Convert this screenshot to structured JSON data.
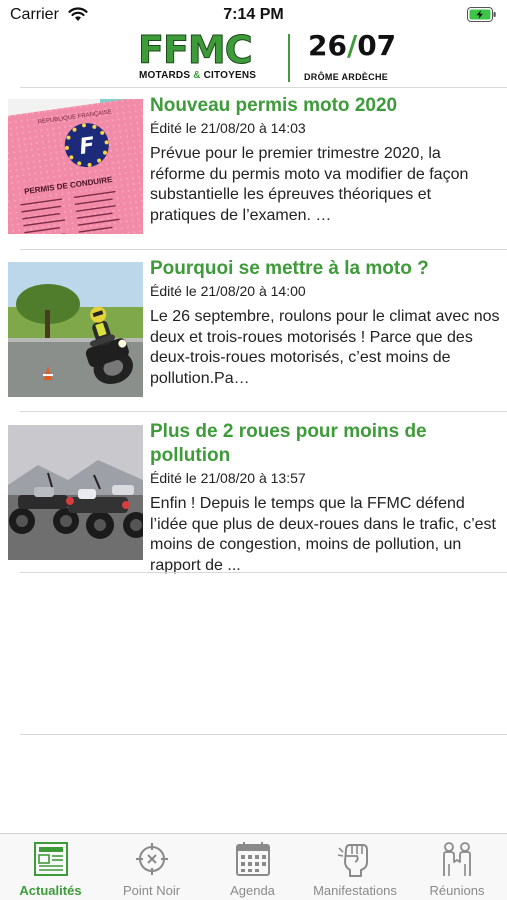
{
  "status_bar": {
    "carrier": "Carrier",
    "time": "7:14 PM",
    "wifi_icon": "wifi-icon",
    "battery_icon": "battery-charging-icon"
  },
  "header": {
    "logo_main": "FFMC",
    "logo_sub_left": "MOTARDS",
    "logo_sub_amp": "&",
    "logo_sub_right": "CITOYENS",
    "logo_num_left": "26",
    "logo_num_slash": "/",
    "logo_num_right": "07",
    "logo_region": "DRÔME ARDÈCHE"
  },
  "news": [
    {
      "title": "Nouveau permis moto 2020",
      "date": "Édité le 21/08/20 à 14:03",
      "excerpt": "Prévue pour le premier trimestre 2020, la réforme du permis moto va modifier de façon substantielle les épreuves théoriques et pratiques de l’examen. …",
      "thumb": {
        "card_header": "RÉPUBLIQUE FRANÇAISE",
        "card_letter": "F",
        "card_label": "PERMIS DE CONDUIRE"
      }
    },
    {
      "title": "Pourquoi se mettre à la moto ?",
      "date": "Édité le 21/08/20 à 14:00",
      "excerpt": "Le 26 septembre, roulons pour le climat avec nos deux et trois-roues motorisés ! Parce que des deux-trois-roues motorisés, c’est moins de pollution.Pa…"
    },
    {
      "title": "Plus de 2 roues pour moins de pollution",
      "date": "Édité le 21/08/20 à 13:57",
      "excerpt": "Enfin ! Depuis le temps que la FFMC défend l’idée que plus de deux-roues dans le trafic, c’est moins de congestion, moins de pollution, un rapport de ..."
    }
  ],
  "tabs": [
    {
      "label": "Actualités",
      "icon": "newspaper-icon",
      "active": true
    },
    {
      "label": "Point Noir",
      "icon": "crosshair-icon",
      "active": false
    },
    {
      "label": "Agenda",
      "icon": "calendar-icon",
      "active": false
    },
    {
      "label": "Manifestations",
      "icon": "raised-fist-icon",
      "active": false
    },
    {
      "label": "Réunions",
      "icon": "people-icon",
      "active": false
    }
  ],
  "colors": {
    "accent": "#3e9b3a",
    "inactive_tab": "#8a8a8a",
    "separator": "#d9d9d9"
  }
}
